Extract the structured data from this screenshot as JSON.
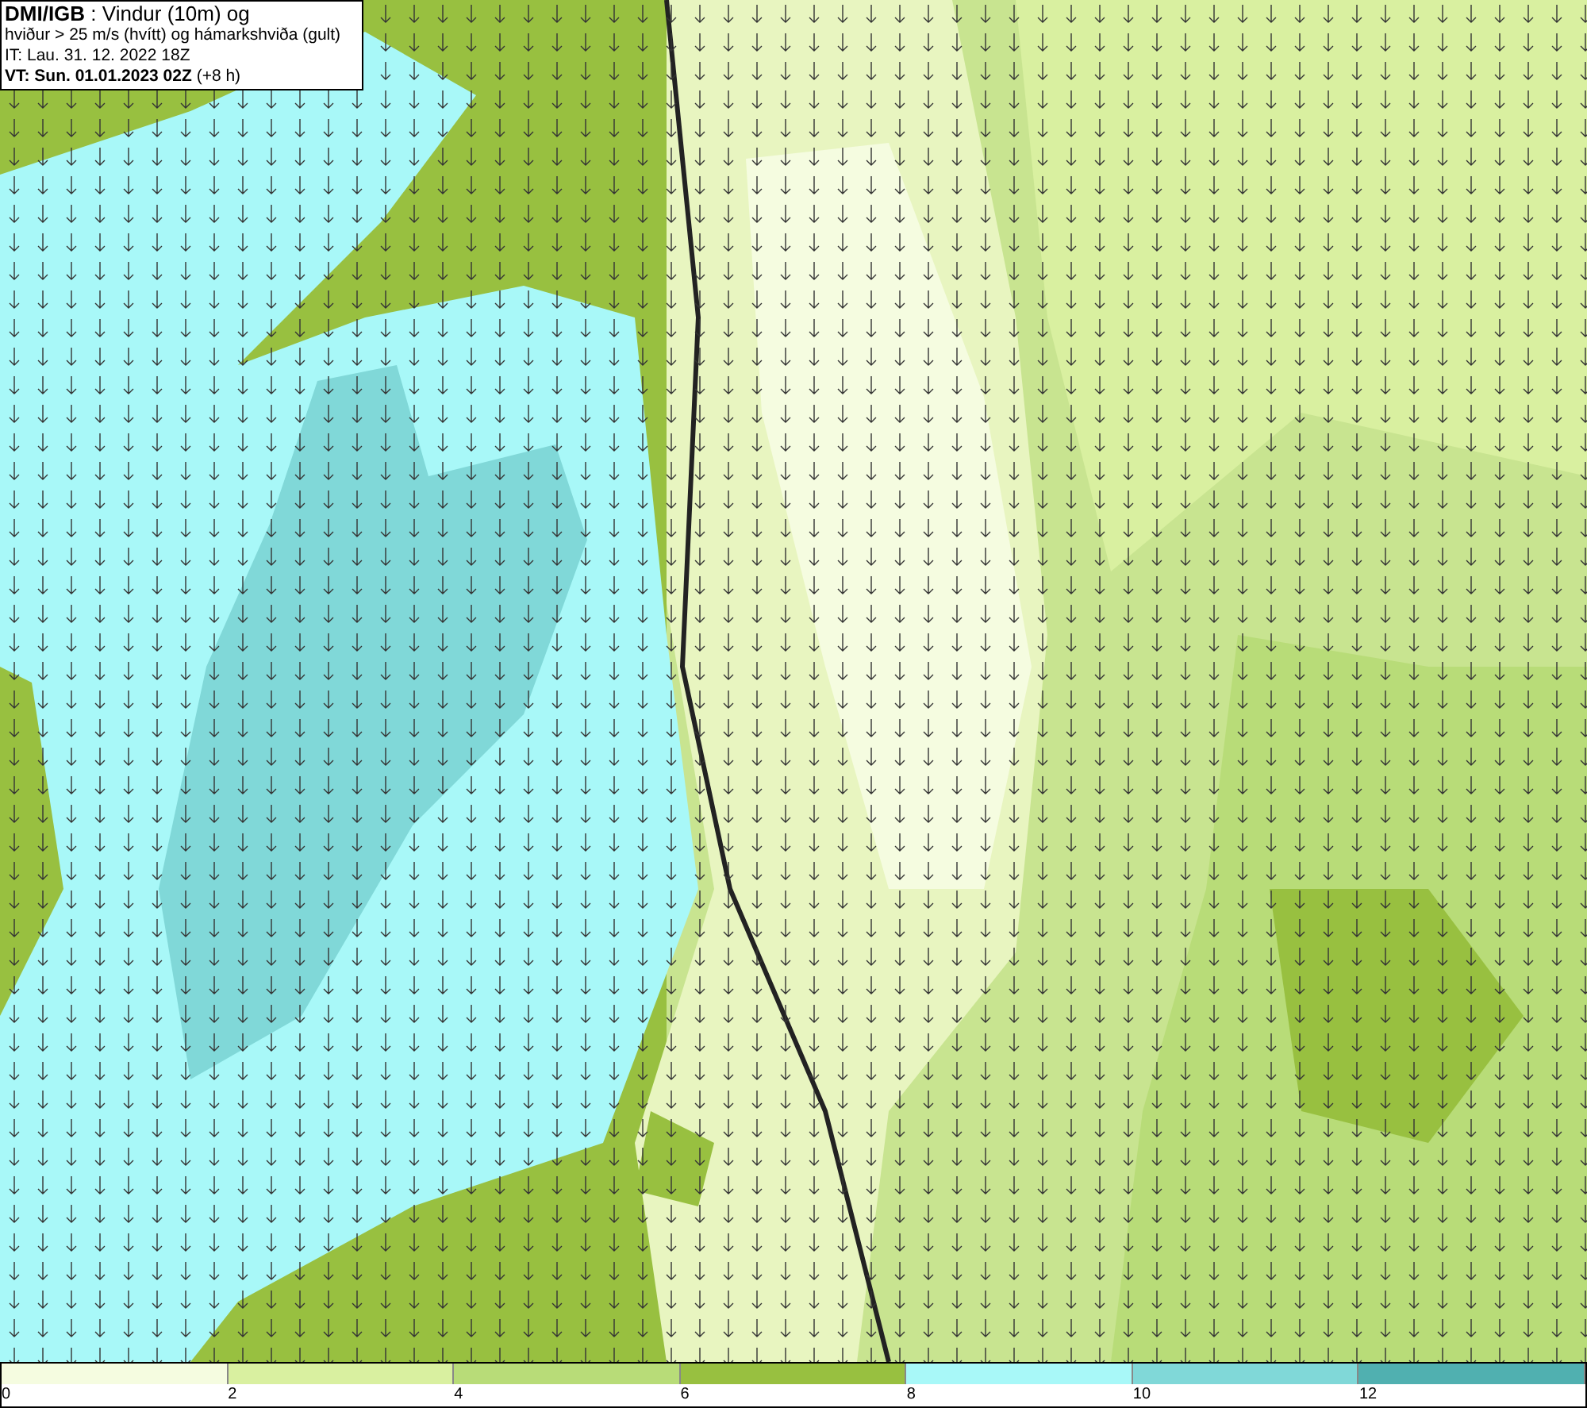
{
  "info_box": {
    "lines": [
      "**DMI/IGB** : Vindur (10m) og",
      "hviður > 25 m/s (hvítt) og hámarkshviða (gult)",
      "IT: Lau. 31. 12. 2022 18Z",
      "**VT: Sun. 01.01.2023 02Z** (+8 h)"
    ]
  },
  "legend": [
    {
      "label": "0",
      "color": "#f5fce0"
    },
    {
      "label": "2",
      "color": "#d9f0a0"
    },
    {
      "label": "4",
      "color": "#b8dc78"
    },
    {
      "label": "6",
      "color": "#98c040"
    },
    {
      "label": "8",
      "color": "#a8f8f8"
    },
    {
      "label": "10",
      "color": "#80d8d8"
    },
    {
      "label": "12",
      "color": "#50b0b0"
    }
  ]
}
